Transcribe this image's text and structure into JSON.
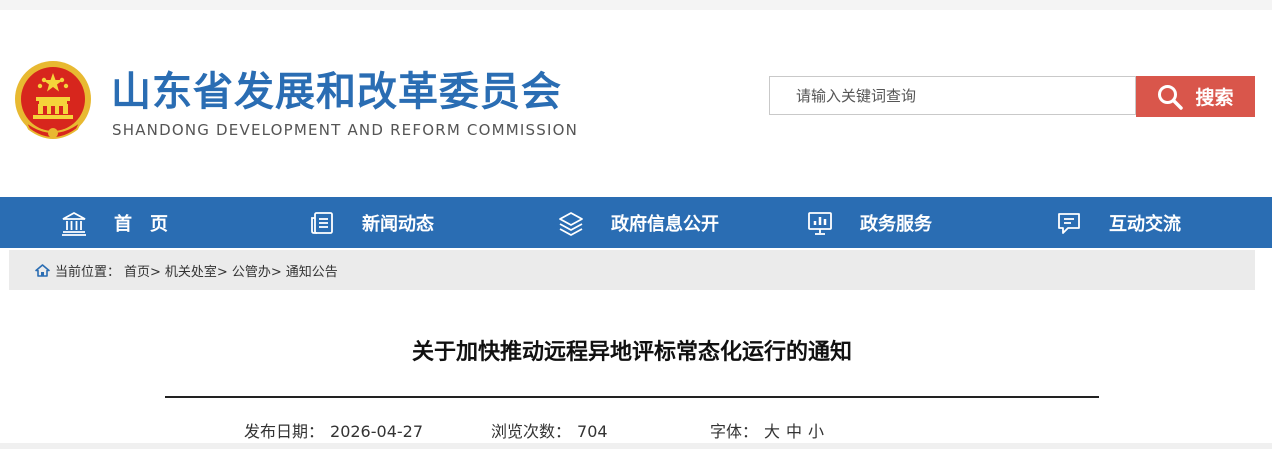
{
  "header": {
    "title": "山东省发展和改革委员会",
    "subtitle": "SHANDONG DEVELOPMENT AND REFORM COMMISSION",
    "search_placeholder": "请输入关键词查询",
    "search_button": "搜索"
  },
  "nav": {
    "items": [
      {
        "label": "首　页",
        "icon": "building-icon"
      },
      {
        "label": "新闻动态",
        "icon": "news-icon"
      },
      {
        "label": "政府信息公开",
        "icon": "layers-icon"
      },
      {
        "label": "政务服务",
        "icon": "chart-monitor-icon"
      },
      {
        "label": "互动交流",
        "icon": "chat-icon"
      }
    ]
  },
  "breadcrumb": {
    "prefix": "当前位置：",
    "items": [
      "首页>",
      "机关处室>",
      "公管办>",
      "通知公告"
    ]
  },
  "article": {
    "title": "关于加快推动远程异地评标常态化运行的通知",
    "date_label": "发布日期：",
    "date": "2026-04-27",
    "views_label": "浏览次数：",
    "views": "704",
    "font_label": "字体：",
    "font_sizes": [
      "大",
      "中",
      "小"
    ]
  },
  "colors": {
    "brand_blue": "#2a6db3",
    "search_red": "#d9564b",
    "breadcrumb_bg": "#ebebeb"
  }
}
